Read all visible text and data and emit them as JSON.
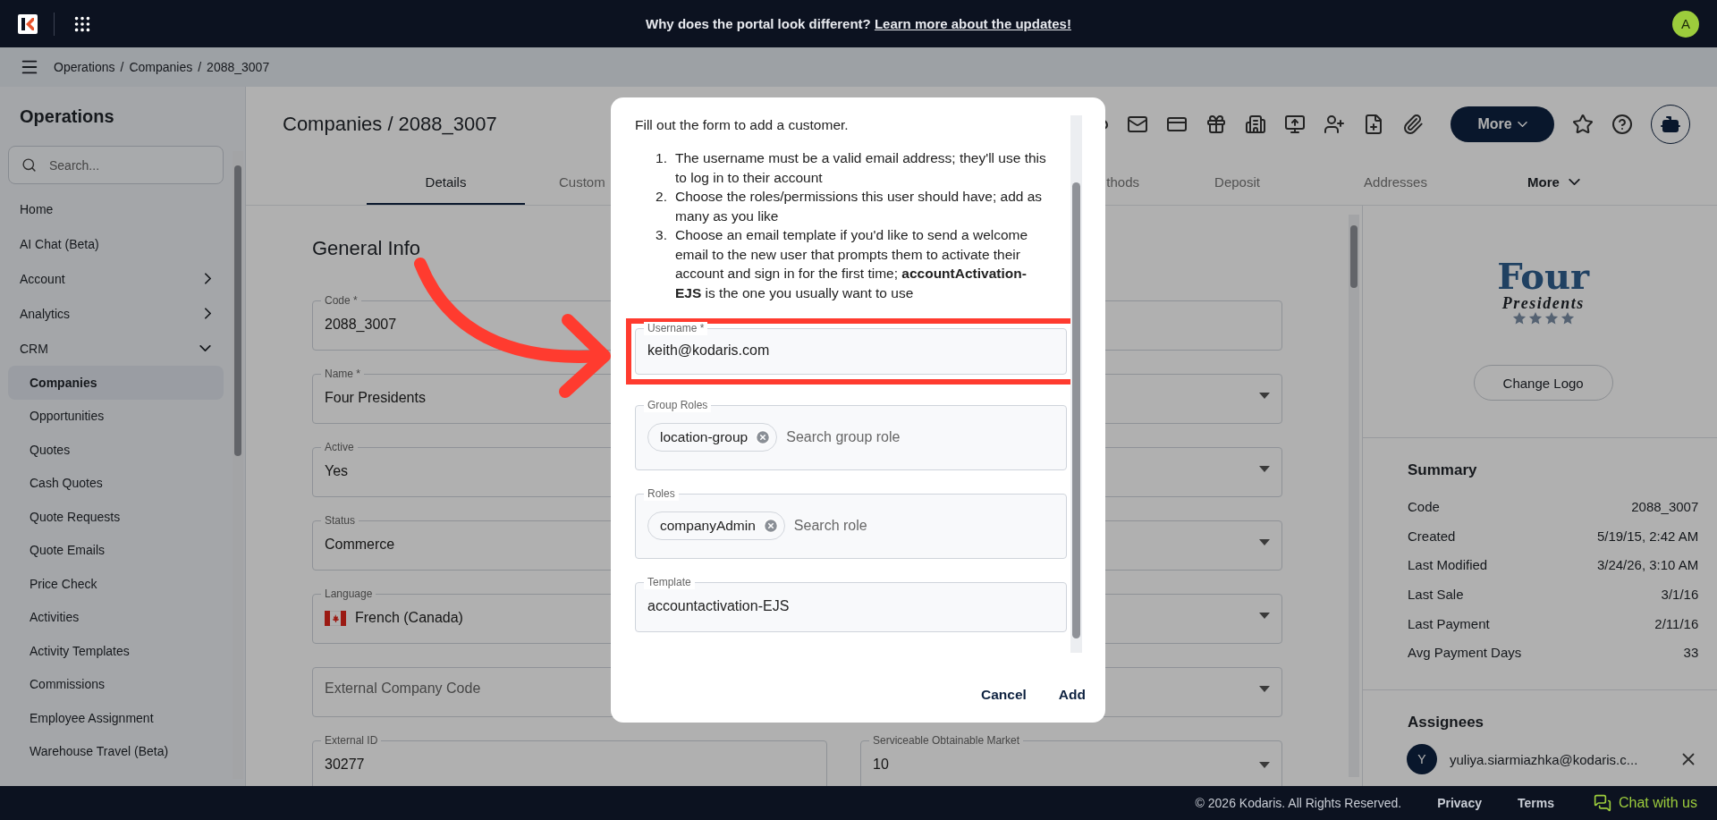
{
  "top_bar": {
    "banner": "Why does the portal look different?",
    "banner_link": "Learn more about the updates!",
    "avatar": "A"
  },
  "breadcrumb": {
    "separator": "/",
    "items": [
      "Operations",
      "Companies",
      "2088_3007"
    ]
  },
  "sidebar": {
    "title": "Operations",
    "search": {
      "placeholder": "Search..."
    },
    "items": [
      {
        "label": "Home",
        "selected": false
      },
      {
        "label": "AI Chat (Beta)",
        "selected": false
      },
      {
        "label": "Account",
        "selected": false,
        "expanded": false
      },
      {
        "label": "Analytics",
        "selected": false,
        "expanded": false
      },
      {
        "label": "CRM",
        "selected": false,
        "expanded": true,
        "children": [
          {
            "label": "Companies",
            "selected": true
          },
          {
            "label": "Opportunities",
            "selected": false
          },
          {
            "label": "Quotes",
            "selected": false
          },
          {
            "label": "Cash Quotes",
            "selected": false
          },
          {
            "label": "Quote Requests",
            "selected": false
          },
          {
            "label": "Quote Emails",
            "selected": false
          },
          {
            "label": "Price Check",
            "selected": false
          },
          {
            "label": "Activities",
            "selected": false
          },
          {
            "label": "Activity Templates",
            "selected": false
          },
          {
            "label": "Commissions",
            "selected": false
          },
          {
            "label": "Employee Assignment",
            "selected": false
          },
          {
            "label": "Warehouse Travel (Beta)",
            "selected": false
          }
        ]
      }
    ]
  },
  "page": {
    "title": "Companies / 2088_3007",
    "more_button": "More"
  },
  "tabs": [
    {
      "label": "Details",
      "selected": true
    },
    {
      "label": "Custom",
      "selected": false
    },
    {
      "label": "thods",
      "selected": false
    },
    {
      "label": "Deposit",
      "selected": false
    },
    {
      "label": "Addresses",
      "selected": false
    },
    {
      "label": "More",
      "selected": false,
      "kind": "menu"
    }
  ],
  "general_info": {
    "title": "General Info",
    "left_fields": [
      {
        "kind": "text",
        "label": "Code *",
        "value": "2088_3007"
      },
      {
        "kind": "select",
        "label": "Name *",
        "value": "Four Presidents"
      },
      {
        "kind": "select",
        "label": "Active",
        "value": "Yes"
      },
      {
        "kind": "select",
        "label": "Status",
        "value": "Commerce"
      },
      {
        "kind": "language",
        "label": "Language",
        "value": "French (Canada)"
      },
      {
        "kind": "select",
        "placeholder": "External Company Code"
      },
      {
        "kind": "text",
        "label": "External ID",
        "value": "30277"
      }
    ],
    "right_fields": [
      {
        "kind": "text"
      },
      {
        "kind": "select"
      },
      {
        "kind": "select"
      },
      {
        "kind": "select"
      },
      {
        "kind": "select"
      },
      {
        "kind": "select"
      },
      {
        "kind": "select",
        "label": "Serviceable Obtainable Market",
        "value": "10"
      }
    ]
  },
  "side_panel": {
    "logo": {
      "title": "Four",
      "subtitle": "Presidents"
    },
    "change_logo": "Change Logo",
    "summary_title": "Summary",
    "summary": [
      {
        "label": "Code",
        "value": "2088_3007"
      },
      {
        "label": "Created",
        "value": "5/19/15, 2:42 AM"
      },
      {
        "label": "Last Modified",
        "value": "3/24/26, 3:10 AM"
      },
      {
        "label": "Last Sale",
        "value": "3/1/16"
      },
      {
        "label": "Last Payment",
        "value": "2/11/16"
      },
      {
        "label": "Avg Payment Days",
        "value": "33"
      }
    ],
    "assignees_title": "Assignees",
    "assignees": [
      {
        "initial": "Y",
        "email": "yuliya.siarmiazhka@kodaris.c..."
      }
    ]
  },
  "dialog": {
    "intro": "Fill out the form to add a customer.",
    "steps": [
      {
        "marker": "1.",
        "text": "The username must be a valid email address; they'll use this to log in to their account"
      },
      {
        "marker": "2.",
        "text": "Choose the roles/permissions this user should have; add as many as you like"
      },
      {
        "marker": "3.",
        "text": "Choose an email template if you'd like to send a welcome email to the new user that prompts them to activate their account and sign in for the first time; **accountActivation-EJS** is the one you usually want to use"
      }
    ],
    "fields": [
      {
        "kind": "text",
        "label": "Username *",
        "value": "keith@kodaris.com",
        "highlighted": true
      },
      {
        "kind": "chips",
        "label": "Group Roles",
        "chips": [
          "location-group"
        ],
        "placeholder": "Search group role",
        "highlighted": false
      },
      {
        "kind": "chips",
        "label": "Roles",
        "chips": [
          "companyAdmin"
        ],
        "placeholder": "Search role",
        "highlighted": false
      },
      {
        "kind": "text",
        "label": "Template",
        "value": "accountactivation-EJS",
        "highlighted": false
      }
    ],
    "pointer_arrow": true,
    "buttons": [
      "Cancel",
      "Add"
    ]
  },
  "footer": {
    "copyright": "© 2026 Kodaris. All Rights Reserved.",
    "links": [
      "Privacy",
      "Terms"
    ],
    "chat": "Chat with us"
  }
}
